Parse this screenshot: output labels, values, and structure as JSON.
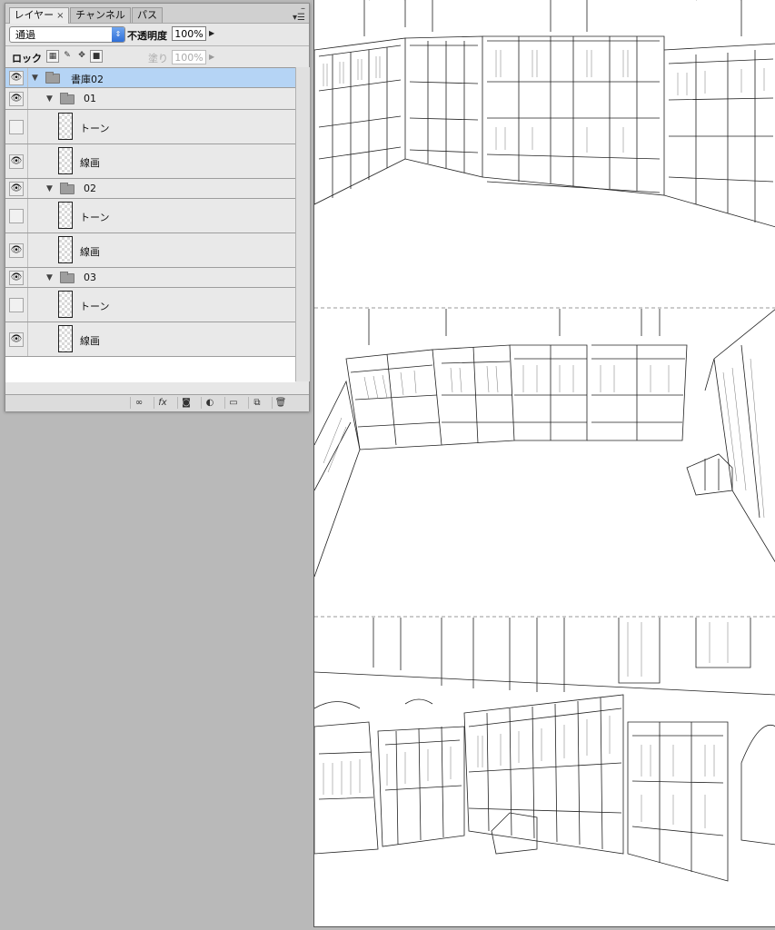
{
  "panel": {
    "tabs": [
      {
        "label": "レイヤー",
        "close": "×"
      },
      {
        "label": "チャンネル"
      },
      {
        "label": "パス"
      }
    ],
    "menu_icon": "panel-menu-icon",
    "blend_mode": "通過",
    "opacity_label": "不透明度 :",
    "opacity_value": "100%",
    "lock_label": "ロック :",
    "fill_label": "塗り :",
    "fill_value": "100%"
  },
  "layers": [
    {
      "type": "group",
      "name": "書庫02",
      "visible": true,
      "selected": true,
      "level": 0
    },
    {
      "type": "group",
      "name": "01",
      "visible": true,
      "level": 1
    },
    {
      "type": "layer",
      "name": "トーン",
      "visible": false,
      "level": 2
    },
    {
      "type": "layer",
      "name": "線画",
      "visible": true,
      "level": 2
    },
    {
      "type": "group",
      "name": "02",
      "visible": true,
      "level": 1
    },
    {
      "type": "layer",
      "name": "トーン",
      "visible": false,
      "level": 2
    },
    {
      "type": "layer",
      "name": "線画",
      "visible": true,
      "level": 2
    },
    {
      "type": "group",
      "name": "03",
      "visible": true,
      "level": 1
    },
    {
      "type": "layer",
      "name": "トーン",
      "visible": false,
      "level": 2
    },
    {
      "type": "layer",
      "name": "線画",
      "visible": true,
      "level": 2
    }
  ],
  "bottom_icons": [
    "link-icon",
    "fx-icon",
    "mask-icon",
    "adjustment-icon",
    "new-group-icon",
    "new-layer-icon",
    "trash-icon"
  ],
  "colors": {
    "selected_row": "#b5d4f5",
    "accent": "#2f6fd8"
  }
}
